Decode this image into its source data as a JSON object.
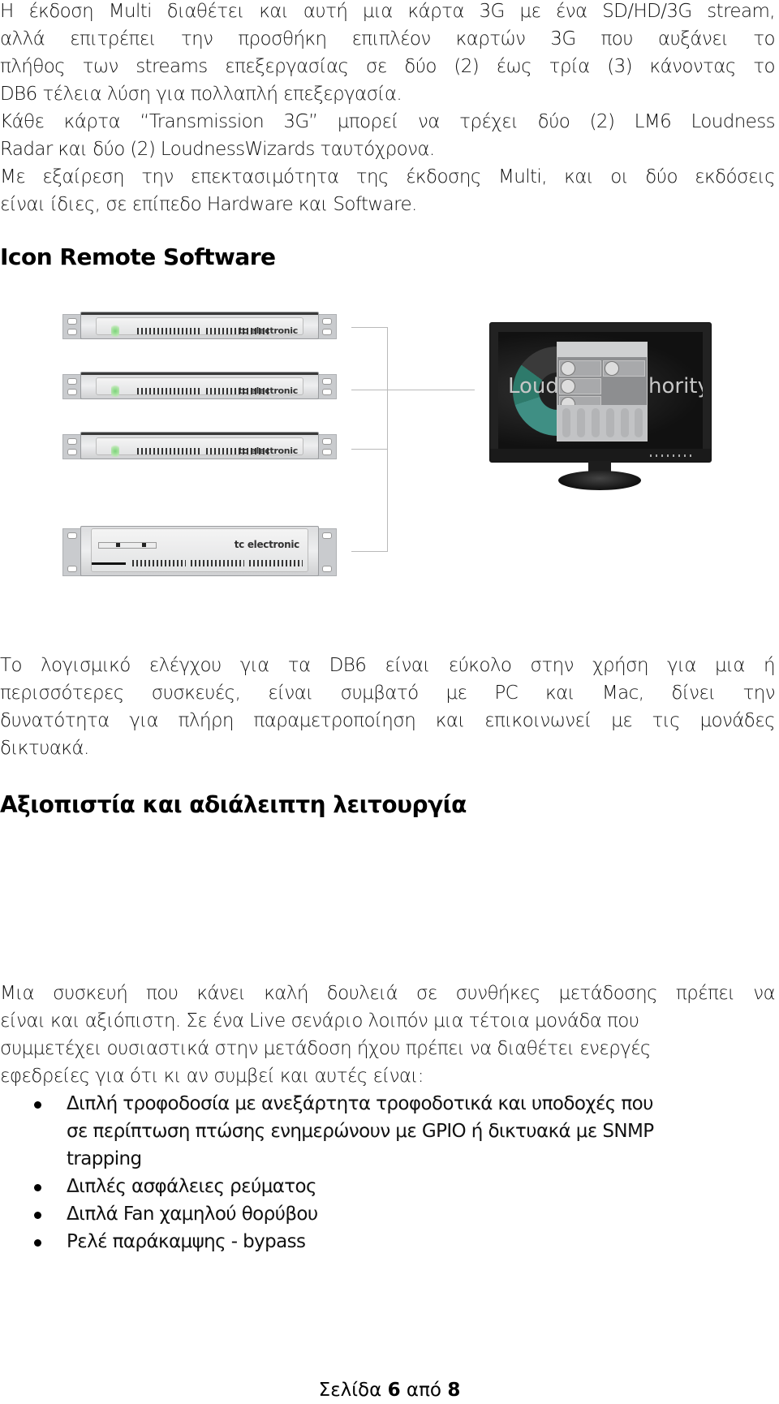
{
  "intro_paragraph": {
    "lines": [
      "Η έκδοση Multi διαθέτει και αυτή μια κάρτα 3G με ένα SD/HD/3G stream,",
      "αλλά επιτρέπει την προσθήκη επιπλέον καρτών 3G που αυξάνει το",
      "πλήθος των streams επεξεργασίας σε δύο (2) έως τρία (3) κάνοντας το",
      "DB6 τέλεια λύση για πολλαπλή επεξεργασία.",
      "Κάθε κάρτα “Transmission 3G” μπορεί να τρέχει δύο (2) LM6 Loudness",
      "Radar και δύο (2) LoudnessWizards ταυτόχρονα.",
      "Με εξαίρεση την επεκτασιμότητα της έκδοσης Multi, και οι δύο εκδόσεις",
      "είναι ίδιες, σε επίπεδο Hardware και Software."
    ]
  },
  "section1": {
    "heading": "Icon Remote Software",
    "figure": {
      "devices": [
        {
          "brand": "tc electronic"
        },
        {
          "brand": "tc electronic"
        },
        {
          "brand": "tc electronic"
        },
        {
          "brand": "tc electronic"
        }
      ],
      "monitor_text_left": "Loud",
      "monitor_text_right": "hority"
    },
    "paragraph_lines": [
      "Το λογισμικό ελέγχου για τα DB6 είναι εύκολο στην χρήση για μια ή",
      "περισσότερες συσκευές, είναι συμβατό με PC και Mac, δίνει την",
      "δυνατότητα για πλήρη παραμετροποίηση και επικοινωνεί με τις μονάδες",
      "δικτυακά."
    ]
  },
  "section2": {
    "heading": "Αξιοπιστία και αδιάλειπτη λειτουργία",
    "paragraph_lines": [
      "Μια συσκευή που κάνει καλή δουλειά σε συνθήκες μετάδοσης πρέπει να",
      "είναι και αξιόπιστη. Σε ένα Live σενάριο λοιπόν μια τέτοια μονάδα που",
      "συμμετέχει ουσιαστικά στην μετάδοση ήχου πρέπει να διαθέτει ενεργές",
      "εφεδρείες για ότι κι αν συμβεί και αυτές είναι:"
    ],
    "bullets": [
      {
        "lines": [
          "Διπλή τροφοδοσία με ανεξάρτητα τροφοδοτικά και υποδοχές που",
          "σε περίπτωση πτώσης ενημερώνουν με GPIO ή δικτυακά με SNMP",
          "trapping"
        ]
      },
      {
        "lines": [
          "Διπλές ασφάλειες ρεύματος"
        ]
      },
      {
        "lines": [
          "Διπλά Fan χαμηλού θορύβου"
        ]
      },
      {
        "lines": [
          "Ρελέ παράκαμψης - bypass"
        ]
      }
    ]
  },
  "footer": {
    "page_label": "Σελίδα",
    "current_page": "6",
    "of_label": "από",
    "total_pages": "8"
  }
}
